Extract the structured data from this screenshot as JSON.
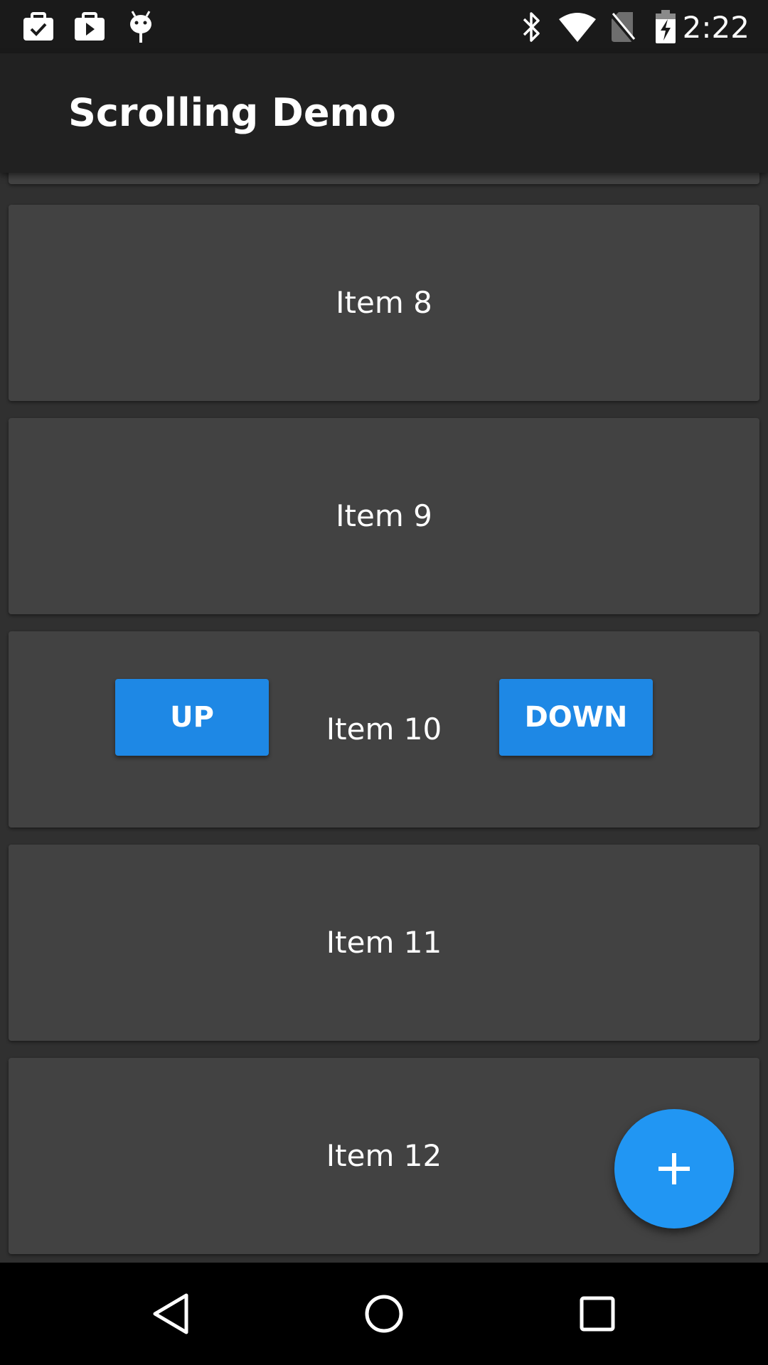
{
  "status_bar": {
    "time": "2:22",
    "left_icons": [
      "briefcase-check-icon",
      "briefcase-play-icon",
      "android-debug-icon"
    ],
    "right_icons": [
      "bluetooth-icon",
      "wifi-icon",
      "no-sim-icon",
      "battery-charging-icon"
    ]
  },
  "app_bar": {
    "title": "Scrolling Demo"
  },
  "list": {
    "items": [
      {
        "label": ""
      },
      {
        "label": "Item 8"
      },
      {
        "label": "Item 9"
      },
      {
        "label": "Item 10",
        "up_label": "UP",
        "down_label": "DOWN"
      },
      {
        "label": "Item 11"
      },
      {
        "label": "Item 12"
      }
    ]
  },
  "fab": {
    "icon": "plus-icon",
    "color": "#2196f3"
  },
  "nav_bar": {
    "icons": [
      "back-icon",
      "home-icon",
      "recents-icon"
    ]
  },
  "colors": {
    "background": "#303030",
    "card": "#424242",
    "app_bar": "#212121",
    "accent_button": "#1e88e5"
  }
}
